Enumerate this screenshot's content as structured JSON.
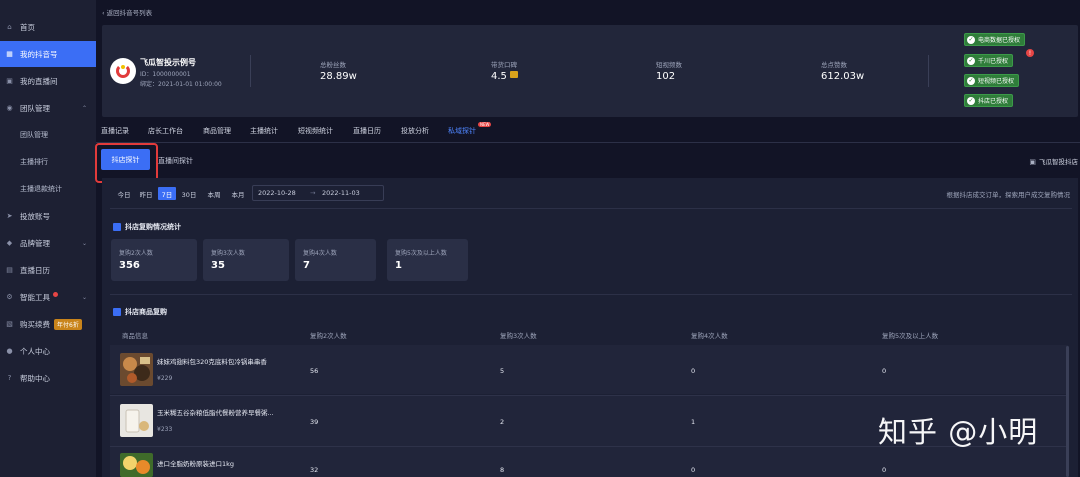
{
  "sidebar": {
    "items": [
      {
        "label": "首页",
        "icon": "home-icon"
      },
      {
        "label": "我的抖音号",
        "icon": "douyin-icon",
        "active": true
      },
      {
        "label": "我的直播间",
        "icon": "live-room-icon"
      },
      {
        "label": "团队管理",
        "icon": "team-icon",
        "expanded": true
      },
      {
        "label": "团队管理"
      },
      {
        "label": "主播排行"
      },
      {
        "label": "主播退款统计"
      },
      {
        "label": "投放账号",
        "icon": "send-icon"
      },
      {
        "label": "品牌管理",
        "icon": "brand-icon"
      },
      {
        "label": "直播日历",
        "icon": "calendar-icon"
      },
      {
        "label": "智能工具",
        "icon": "tool-icon"
      },
      {
        "label": "购买续费",
        "icon": "cart-icon",
        "badge": "年付6折"
      },
      {
        "label": "个人中心",
        "icon": "user-icon"
      },
      {
        "label": "帮助中心",
        "icon": "help-icon"
      }
    ]
  },
  "back_link": "返回抖音号列表",
  "profile": {
    "name": "飞瓜智投示例号",
    "id": "ID：1000000001",
    "bind_time": "绑定：2021-01-01 01:00:00",
    "stats": [
      {
        "label": "总粉丝数",
        "value": "28.89w"
      },
      {
        "label": "带货口碑",
        "value": "4.5"
      },
      {
        "label": "短视频数",
        "value": "102"
      },
      {
        "label": "总点赞数",
        "value": "612.03w"
      }
    ],
    "auth_badges": [
      "电商数据已授权",
      "千川已授权",
      "短视频已授权",
      "抖店已授权"
    ],
    "alert": "!"
  },
  "tabs": [
    "直播记录",
    "店长工作台",
    "商品管理",
    "主播统计",
    "短视频统计",
    "直播日历",
    "投放分析",
    "私域探针"
  ],
  "new_badge": "NEW",
  "subtabs": [
    "抖店探针",
    "直播间探针"
  ],
  "store_label": "飞瓜智投抖店",
  "date_range": {
    "buttons": [
      "今日",
      "昨日",
      "7日",
      "30日",
      "本周",
      "本月"
    ],
    "active": "7日",
    "start": "2022-10-28",
    "arrow": "→",
    "end": "2022-11-03"
  },
  "hint": "根据抖店成交订单，探索用户成交复购情况",
  "repurchase_stats": {
    "title": "抖店复购情况统计",
    "cards": [
      {
        "label": "复购2次人数",
        "value": "356"
      },
      {
        "label": "复购3次人数",
        "value": "35"
      },
      {
        "label": "复购4次人数",
        "value": "7"
      },
      {
        "label": "复购5次及以上人数",
        "value": "1"
      }
    ]
  },
  "product_table": {
    "title": "抖店商品复购",
    "columns": [
      "商品信息",
      "复购2次人数",
      "复购3次人数",
      "复购4次人数",
      "复购5次及以上人数"
    ],
    "rows": [
      {
        "name": "妹妹鸡翅料包320克底料包冷锅串串香",
        "price": "¥229",
        "c2": "56",
        "c3": "5",
        "c4": "0",
        "c5": "0"
      },
      {
        "name": "玉米糊五谷杂粮低脂代餐粉营养早餐粥...",
        "price": "¥233",
        "c2": "39",
        "c3": "2",
        "c4": "1",
        "c5": "0"
      },
      {
        "name": "进口全脂奶粉原装进口1kg",
        "price": "",
        "c2": "32",
        "c3": "8",
        "c4": "0",
        "c5": "0"
      }
    ]
  },
  "watermark": "知乎 @小明",
  "colors": {
    "accent": "#3b6ef5",
    "auth_green": "#2f7d3a",
    "highlight_box": "#e23b3b"
  }
}
